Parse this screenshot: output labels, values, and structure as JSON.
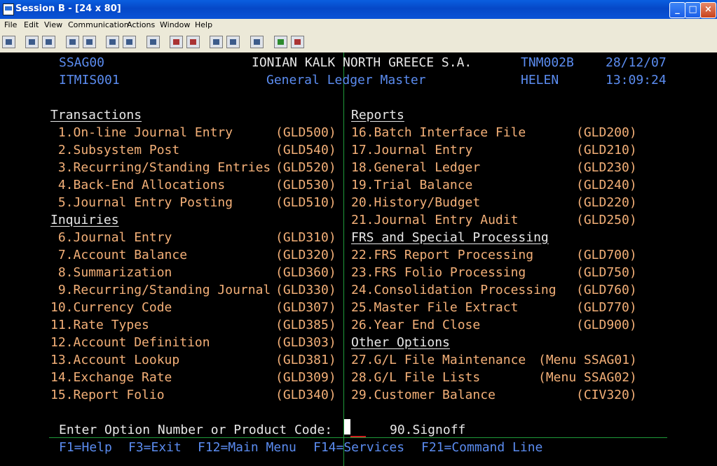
{
  "window": {
    "title": "Session B - [24 x 80]",
    "min": "_",
    "max": "□",
    "close": "×"
  },
  "menu": [
    "File",
    "Edit",
    "View",
    "Communication",
    "Actions",
    "Window",
    "Help"
  ],
  "header": {
    "system": "SSAG00",
    "company": "IONIAN KALK NORTH GREECE S.A.",
    "device": "TNM002B",
    "date": "28/12/07",
    "program": "ITMIS001",
    "screen_title": "General Ledger Master",
    "user": "HELEN",
    "time": "13:09:24"
  },
  "sections": {
    "transactions": "Transactions",
    "inquiries": "Inquiries",
    "reports": "Reports",
    "frs": "FRS and Special Processing",
    "other": "Other Options"
  },
  "left_items": [
    {
      "label": " 1.On-line Journal Entry",
      "code": "(GLD500)"
    },
    {
      "label": " 2.Subsystem Post",
      "code": "(GLD540)"
    },
    {
      "label": " 3.Recurring/Standing Entries",
      "code": "(GLD520)"
    },
    {
      "label": " 4.Back-End Allocations",
      "code": "(GLD530)"
    },
    {
      "label": " 5.Journal Entry Posting",
      "code": "(GLD510)"
    },
    {
      "label": " 6.Journal Entry",
      "code": "(GLD310)"
    },
    {
      "label": " 7.Account Balance",
      "code": "(GLD320)"
    },
    {
      "label": " 8.Summarization",
      "code": "(GLD360)"
    },
    {
      "label": " 9.Recurring/Standing Journal",
      "code": "(GLD330)"
    },
    {
      "label": "10.Currency Code",
      "code": "(GLD307)"
    },
    {
      "label": "11.Rate Types",
      "code": "(GLD385)"
    },
    {
      "label": "12.Account Definition",
      "code": "(GLD303)"
    },
    {
      "label": "13.Account Lookup",
      "code": "(GLD381)"
    },
    {
      "label": "14.Exchange Rate",
      "code": "(GLD309)"
    },
    {
      "label": "15.Report Folio",
      "code": "(GLD340)"
    }
  ],
  "right_items": [
    {
      "label": "16.Batch Interface File",
      "code": "(GLD200)"
    },
    {
      "label": "17.Journal Entry",
      "code": "(GLD210)"
    },
    {
      "label": "18.General Ledger",
      "code": "(GLD230)"
    },
    {
      "label": "19.Trial Balance",
      "code": "(GLD240)"
    },
    {
      "label": "20.History/Budget",
      "code": "(GLD220)"
    },
    {
      "label": "21.Journal Entry Audit",
      "code": "(GLD250)"
    },
    {
      "label": "22.FRS Report Processing",
      "code": "(GLD700)"
    },
    {
      "label": "23.FRS Folio Processing",
      "code": "(GLD750)"
    },
    {
      "label": "24.Consolidation Processing",
      "code": "(GLD760)"
    },
    {
      "label": "25.Master File Extract",
      "code": "(GLD770)"
    },
    {
      "label": "26.Year End Close",
      "code": "(GLD900)"
    },
    {
      "label": "27.G/L File Maintenance",
      "code": "(Menu SSAG01)"
    },
    {
      "label": "28.G/L File Lists",
      "code": "(Menu SSAG02)"
    },
    {
      "label": "29.Customer Balance",
      "code": "(CIV320)"
    }
  ],
  "prompt": {
    "label": "Enter Option Number or Product Code:",
    "value": "",
    "signoff": "90.Signoff"
  },
  "fkeys": [
    "F1=Help",
    "F3=Exit",
    "F12=Main Menu",
    "F14=Services",
    "F21=Command Line"
  ]
}
